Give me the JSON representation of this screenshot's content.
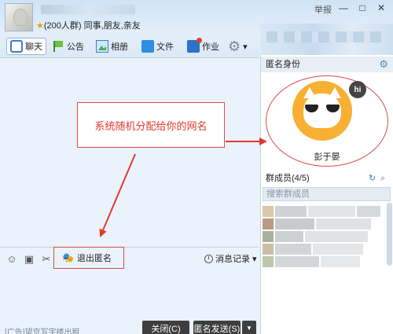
{
  "window": {
    "group_line_star": "★",
    "group_line": "(200人群) 同事,朋友,亲友",
    "report": "举报",
    "min": "—",
    "max": "□",
    "close": "✕"
  },
  "toolbar": {
    "tabs": [
      {
        "label": "聊天",
        "icon": "chat-icon"
      },
      {
        "label": "公告",
        "icon": "flag-icon"
      },
      {
        "label": "相册",
        "icon": "photo-icon"
      },
      {
        "label": "文件",
        "icon": "folder-icon"
      },
      {
        "label": "作业",
        "icon": "homework-icon"
      }
    ],
    "settings_arrow": "▾"
  },
  "annotation": {
    "text": "系统随机分配给你的网名"
  },
  "input_toolbar": {
    "exit_anonymous": "退出匿名",
    "history": "消息记录",
    "history_arrow": "▾"
  },
  "input": {
    "ad_text": "[广告]望京写字楼出租",
    "close_button": "关闭(C)",
    "send_button": "匿名发送(S)",
    "send_dropdown": "▼"
  },
  "right_panel": {
    "anon_header": "匿名身份",
    "anon_name": "彭于晏",
    "hi_badge": "hi",
    "members_header": "群成员(4/5)",
    "search_placeholder": "搜索群成员"
  },
  "colors": {
    "accent": "#3a7bd5",
    "annotation_red": "#e03a2f",
    "avatar_orange": "#f7b033"
  }
}
